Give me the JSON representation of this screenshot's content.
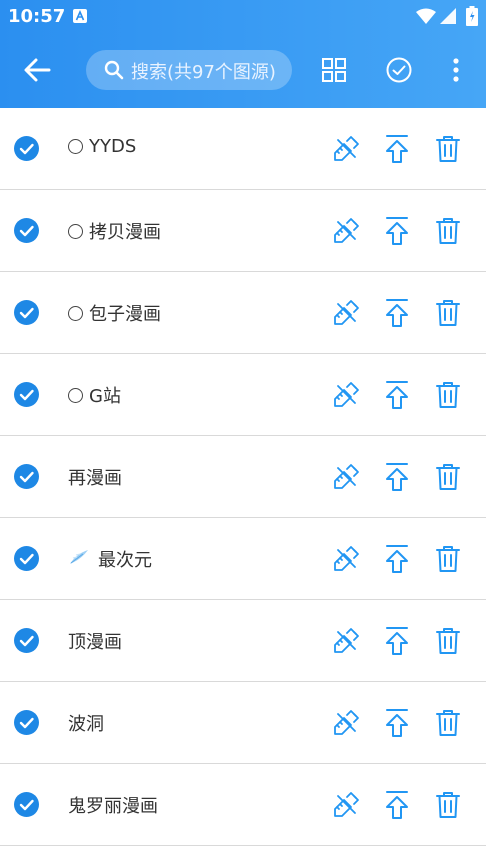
{
  "status_bar": {
    "time": "10:57"
  },
  "app_bar": {
    "search_placeholder": "搜索(共97个图源)"
  },
  "colors": {
    "accent": "#2196F3",
    "checkbox": "#1E88E5"
  },
  "sources": [
    {
      "label": "YYDS",
      "icon": "radio-circle",
      "checked": true
    },
    {
      "label": "拷贝漫画",
      "icon": "radio-circle",
      "checked": true
    },
    {
      "label": "包子漫画",
      "icon": "radio-circle",
      "checked": true
    },
    {
      "label": "G站",
      "icon": "radio-circle",
      "checked": true
    },
    {
      "label": "再漫画",
      "icon": "",
      "checked": true
    },
    {
      "label": "最次元",
      "icon": "feather",
      "checked": true
    },
    {
      "label": "顶漫画",
      "icon": "",
      "checked": true
    },
    {
      "label": "波洞",
      "icon": "",
      "checked": true
    },
    {
      "label": "鬼罗丽漫画",
      "icon": "",
      "checked": true
    }
  ]
}
